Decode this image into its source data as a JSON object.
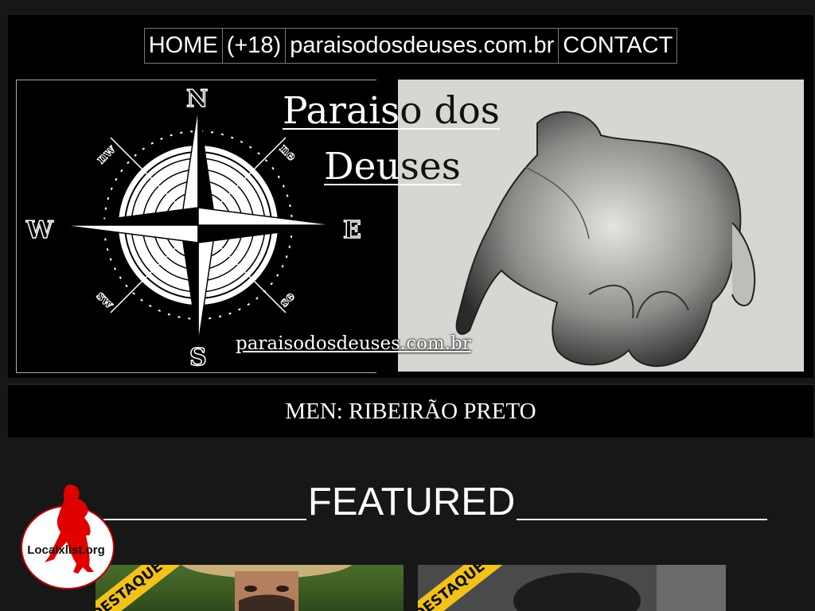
{
  "nav": {
    "items": [
      {
        "label": "HOME"
      },
      {
        "label": "(+18)"
      },
      {
        "label": "paraisodosdeuses.com.br"
      },
      {
        "label": "CONTACT"
      }
    ]
  },
  "banner": {
    "title_line1_light": "Parais",
    "title_line1_dark": "o dos",
    "title_line2_light": "Deu",
    "title_line2_dark": "ses",
    "url": "paraisodosdeuses.com.br",
    "compass_letters": {
      "n": "N",
      "s": "S",
      "e": "E",
      "w": "W",
      "nw": "nw",
      "ne": "ne",
      "sw": "sw",
      "se": "se"
    }
  },
  "city": {
    "title": "MEN: RIBEIRÃO PRETO"
  },
  "featured": {
    "heading": "FEATURED"
  },
  "cards": [
    {
      "badge": "DESTAQUE",
      "icon": "featured-photo"
    },
    {
      "badge": "DESTAQUE",
      "icon": "featured-photo"
    }
  ],
  "watermark": {
    "text": "Localxlist.org",
    "color": "#e00000"
  }
}
